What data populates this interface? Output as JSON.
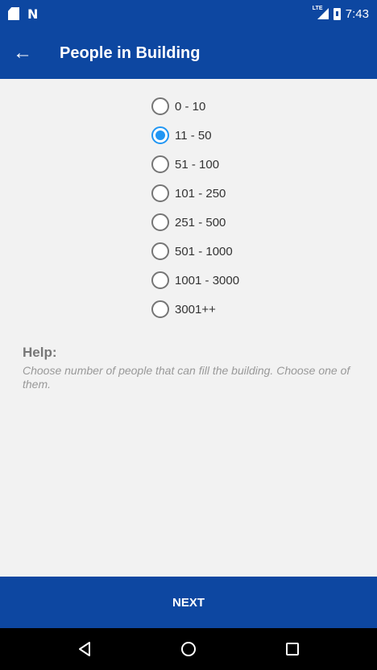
{
  "statusbar": {
    "network": "LTE",
    "time": "7:43",
    "icons": [
      "sd-card-icon",
      "n-icon",
      "signal-icon",
      "battery-icon"
    ]
  },
  "toolbar": {
    "back_icon": "←",
    "title": "People in Building"
  },
  "options": [
    {
      "label": "0 - 10",
      "checked": false
    },
    {
      "label": "11 - 50",
      "checked": true
    },
    {
      "label": "51 - 100",
      "checked": false
    },
    {
      "label": "101 - 250",
      "checked": false
    },
    {
      "label": "251 - 500",
      "checked": false
    },
    {
      "label": "501 - 1000",
      "checked": false
    },
    {
      "label": "1001 - 3000",
      "checked": false
    },
    {
      "label": "3001++",
      "checked": false
    }
  ],
  "help": {
    "title": "Help:",
    "text": "Choose number of people that can fill the building. Choose one of them."
  },
  "footer": {
    "next_label": "NEXT"
  },
  "colors": {
    "primary": "#0d47a1",
    "accent": "#2196f3",
    "background": "#f2f2f2"
  }
}
